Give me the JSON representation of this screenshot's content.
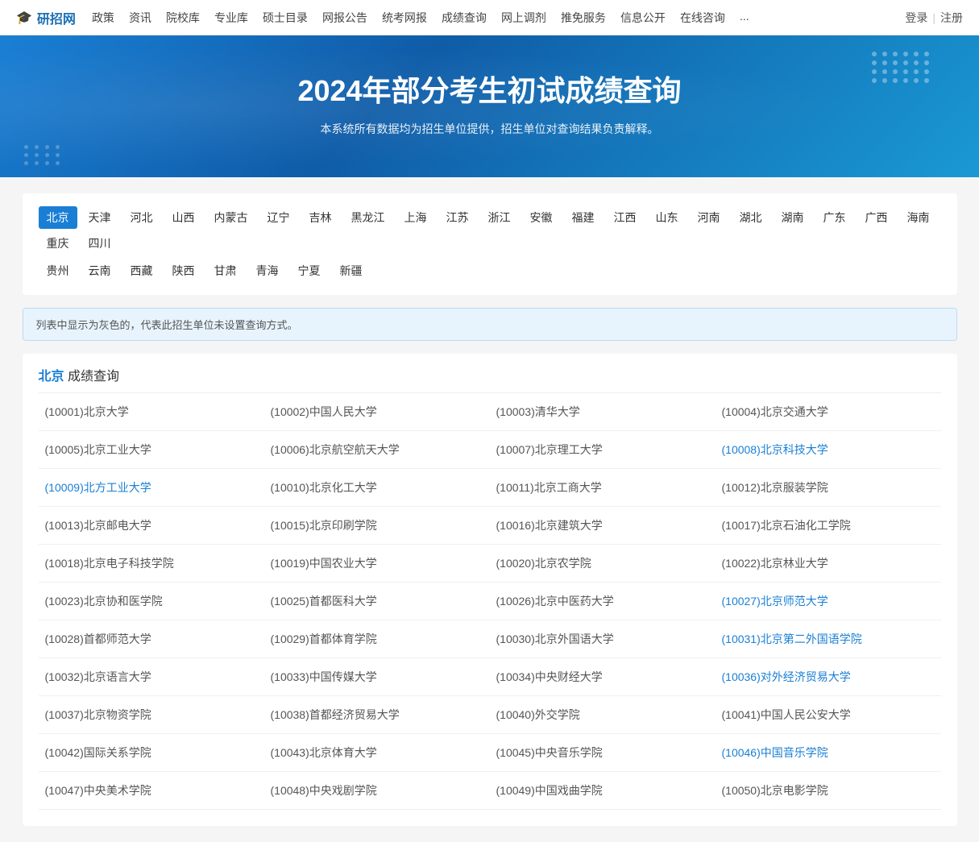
{
  "nav": {
    "logo_icon": "🎓",
    "logo_text": "研招网",
    "links": [
      "政策",
      "资讯",
      "院校库",
      "专业库",
      "硕士目录",
      "网报公告",
      "统考网报",
      "成绩查询",
      "网上调剂",
      "推免服务",
      "信息公开",
      "在线咨询",
      "..."
    ],
    "login": "登录",
    "register": "注册"
  },
  "banner": {
    "title": "2024年部分考生初试成绩查询",
    "subtitle": "本系统所有数据均为招生单位提供，招生单位对查询结果负责解释。"
  },
  "regions": {
    "row1": [
      "北京",
      "天津",
      "河北",
      "山西",
      "内蒙古",
      "辽宁",
      "吉林",
      "黑龙江",
      "上海",
      "江苏",
      "浙江",
      "安徽",
      "福建",
      "江西",
      "山东",
      "河南",
      "湖北",
      "湖南",
      "广东",
      "广西",
      "海南",
      "重庆",
      "四川"
    ],
    "row2": [
      "贵州",
      "云南",
      "西藏",
      "陕西",
      "甘肃",
      "青海",
      "宁夏",
      "新疆"
    ],
    "active": "北京"
  },
  "notice": "列表中显示为灰色的，代表此招生单位未设置查询方式。",
  "section_title": "成绩查询",
  "active_region": "北京",
  "universities": [
    {
      "code": "10001",
      "name": "北京大学",
      "link": false
    },
    {
      "code": "10002",
      "name": "中国人民大学",
      "link": false
    },
    {
      "code": "10003",
      "name": "清华大学",
      "link": false
    },
    {
      "code": "10004",
      "name": "北京交通大学",
      "link": false
    },
    {
      "code": "10005",
      "name": "北京工业大学",
      "link": false
    },
    {
      "code": "10006",
      "name": "北京航空航天大学",
      "link": false
    },
    {
      "code": "10007",
      "name": "北京理工大学",
      "link": false
    },
    {
      "code": "10008",
      "name": "北京科技大学",
      "link": true
    },
    {
      "code": "10009",
      "name": "北方工业大学",
      "link": true
    },
    {
      "code": "10010",
      "name": "北京化工大学",
      "link": false
    },
    {
      "code": "10011",
      "name": "北京工商大学",
      "link": false
    },
    {
      "code": "10012",
      "name": "北京服装学院",
      "link": false
    },
    {
      "code": "10013",
      "name": "北京邮电大学",
      "link": false
    },
    {
      "code": "10015",
      "name": "北京印刷学院",
      "link": false
    },
    {
      "code": "10016",
      "name": "北京建筑大学",
      "link": false
    },
    {
      "code": "10017",
      "name": "北京石油化工学院",
      "link": false
    },
    {
      "code": "10018",
      "name": "北京电子科技学院",
      "link": false
    },
    {
      "code": "10019",
      "name": "中国农业大学",
      "link": false
    },
    {
      "code": "10020",
      "name": "北京农学院",
      "link": false
    },
    {
      "code": "10022",
      "name": "北京林业大学",
      "link": false
    },
    {
      "code": "10023",
      "name": "北京协和医学院",
      "link": false
    },
    {
      "code": "10025",
      "name": "首都医科大学",
      "link": false
    },
    {
      "code": "10026",
      "name": "北京中医药大学",
      "link": false
    },
    {
      "code": "10027",
      "name": "北京师范大学",
      "link": true
    },
    {
      "code": "10028",
      "name": "首都师范大学",
      "link": false
    },
    {
      "code": "10029",
      "name": "首都体育学院",
      "link": false
    },
    {
      "code": "10030",
      "name": "北京外国语大学",
      "link": false
    },
    {
      "code": "10031",
      "name": "北京第二外国语学院",
      "link": true
    },
    {
      "code": "10032",
      "name": "北京语言大学",
      "link": false
    },
    {
      "code": "10033",
      "name": "中国传媒大学",
      "link": false
    },
    {
      "code": "10034",
      "name": "中央财经大学",
      "link": false
    },
    {
      "code": "10036",
      "name": "对外经济贸易大学",
      "link": true
    },
    {
      "code": "10037",
      "name": "北京物资学院",
      "link": false
    },
    {
      "code": "10038",
      "name": "首都经济贸易大学",
      "link": false
    },
    {
      "code": "10040",
      "name": "外交学院",
      "link": false
    },
    {
      "code": "10041",
      "name": "中国人民公安大学",
      "link": false
    },
    {
      "code": "10042",
      "name": "国际关系学院",
      "link": false
    },
    {
      "code": "10043",
      "name": "北京体育大学",
      "link": false
    },
    {
      "code": "10045",
      "name": "中央音乐学院",
      "link": false
    },
    {
      "code": "10046",
      "name": "中国音乐学院",
      "link": true
    },
    {
      "code": "10047",
      "name": "中央美术学院",
      "link": false
    },
    {
      "code": "10048",
      "name": "中央戏剧学院",
      "link": false
    },
    {
      "code": "10049",
      "name": "中国戏曲学院",
      "link": false
    },
    {
      "code": "10050",
      "name": "北京电影学院",
      "link": false
    }
  ]
}
